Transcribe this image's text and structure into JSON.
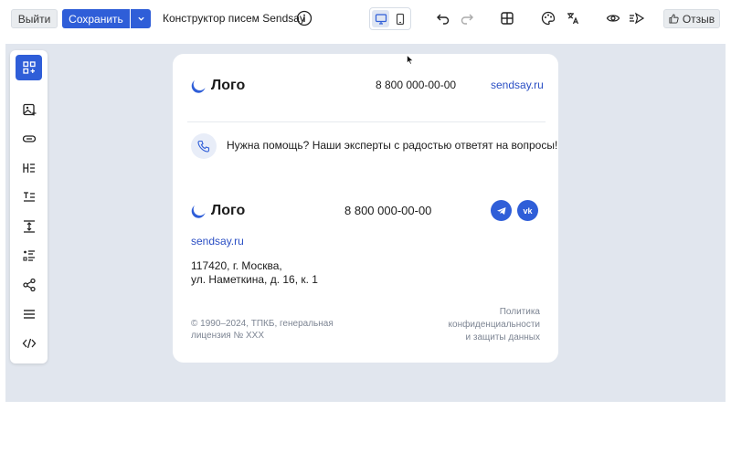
{
  "toolbar": {
    "exit_label": "Выйти",
    "save_label": "Сохранить",
    "title": "Конструктор писем Sendsay",
    "review_label": "Отзыв"
  },
  "icons": {
    "info": "info-icon",
    "desktop": "desktop-icon",
    "mobile": "mobile-icon",
    "undo": "undo-icon",
    "redo": "redo-icon",
    "grid": "grid-icon",
    "palette": "palette-icon",
    "translate": "translate-icon",
    "preview": "eye-icon",
    "send": "send-icon",
    "thumbs_up": "thumbs-up-icon"
  },
  "sidebar": {
    "items": [
      {
        "name": "blocks",
        "icon": "add-blocks-icon"
      },
      {
        "name": "image",
        "icon": "image-icon"
      },
      {
        "name": "button",
        "icon": "button-icon"
      },
      {
        "name": "heading",
        "icon": "heading-icon"
      },
      {
        "name": "text",
        "icon": "text-icon"
      },
      {
        "name": "spacer",
        "icon": "spacer-icon"
      },
      {
        "name": "list",
        "icon": "list-icon"
      },
      {
        "name": "social",
        "icon": "share-icon"
      },
      {
        "name": "menu",
        "icon": "menu-icon"
      },
      {
        "name": "html",
        "icon": "code-icon"
      }
    ]
  },
  "email": {
    "header": {
      "logo_text": "Лого",
      "phone": "8 800 000-00-00",
      "site": "sendsay.ru"
    },
    "help": {
      "text": "Нужна помощь? Наши эксперты с радостью ответят на вопросы!"
    },
    "footer": {
      "logo_text": "Лого",
      "phone": "8 800 000-00-00",
      "social": [
        "telegram",
        "vk"
      ],
      "vk_label": "vk",
      "site": "sendsay.ru",
      "address_line1": "117420, г. Москва,",
      "address_line2": "ул. Наметкина, д. 16, к. 1",
      "copyright_line1": "© 1990–2024, ТПКБ, генеральная",
      "copyright_line2": "лицензия № XXX",
      "policy_line1": "Политика",
      "policy_line2": "конфиденциальности",
      "policy_line3": "и защиты данных"
    }
  },
  "colors": {
    "accent": "#2f5ed8",
    "link": "#2b4fc4",
    "canvas": "#e1e6ee",
    "muted": "#7d8593"
  }
}
